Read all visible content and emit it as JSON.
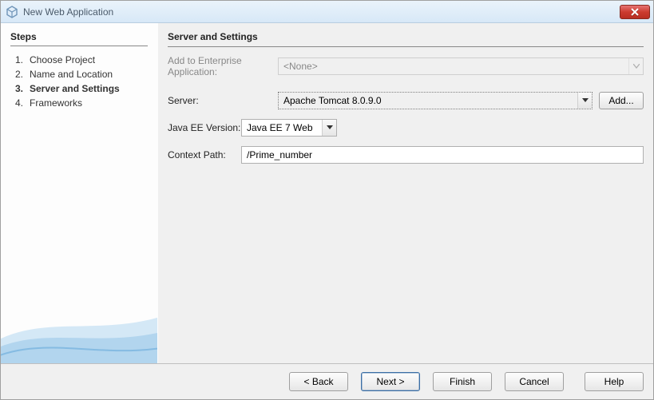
{
  "window": {
    "title": "New Web Application"
  },
  "steps": {
    "heading": "Steps",
    "items": [
      {
        "num": "1.",
        "label": "Choose Project",
        "current": false
      },
      {
        "num": "2.",
        "label": "Name and Location",
        "current": false
      },
      {
        "num": "3.",
        "label": "Server and Settings",
        "current": true
      },
      {
        "num": "4.",
        "label": "Frameworks",
        "current": false
      }
    ]
  },
  "page": {
    "heading": "Server and Settings",
    "enterprise_label": "Add to Enterprise Application:",
    "enterprise_value": "<None>",
    "server_label": "Server:",
    "server_value": "Apache Tomcat 8.0.9.0",
    "add_button": "Add...",
    "javaee_label": "Java EE Version:",
    "javaee_value": "Java EE 7 Web",
    "context_label": "Context Path:",
    "context_value": "/Prime_number"
  },
  "buttons": {
    "back": "< Back",
    "next": "Next >",
    "finish": "Finish",
    "cancel": "Cancel",
    "help": "Help"
  }
}
